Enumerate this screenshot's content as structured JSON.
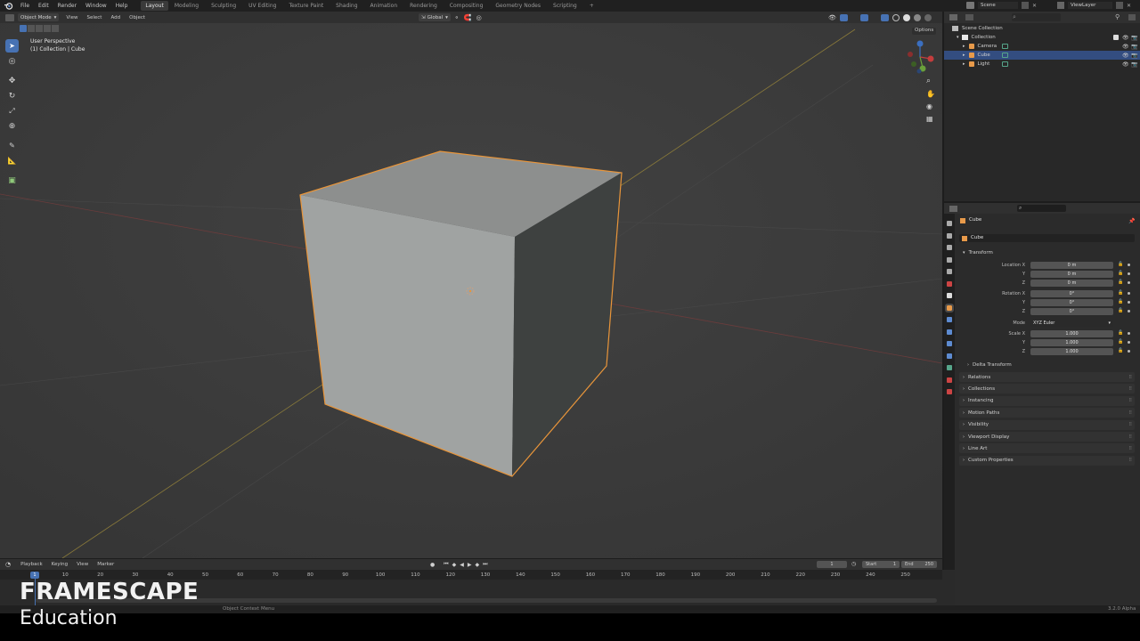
{
  "menu": [
    "File",
    "Edit",
    "Render",
    "Window",
    "Help"
  ],
  "workspaces": [
    {
      "label": "Layout",
      "active": true
    },
    {
      "label": "Modeling"
    },
    {
      "label": "Sculpting"
    },
    {
      "label": "UV Editing"
    },
    {
      "label": "Texture Paint"
    },
    {
      "label": "Shading"
    },
    {
      "label": "Animation"
    },
    {
      "label": "Rendering"
    },
    {
      "label": "Compositing"
    },
    {
      "label": "Geometry Nodes"
    },
    {
      "label": "Scripting"
    }
  ],
  "add_workspace": "+",
  "scene_name": "Scene",
  "view_layer": "ViewLayer",
  "viewport": {
    "mode": "Object Mode",
    "menus": [
      "View",
      "Select",
      "Add",
      "Object"
    ],
    "orientation": "Global",
    "options_label": "Options",
    "overlay_title": "User Perspective",
    "overlay_subtitle": "(1) Collection | Cube"
  },
  "outliner": {
    "root": "Scene Collection",
    "collection": "Collection",
    "items": [
      {
        "name": "Camera",
        "selected": false
      },
      {
        "name": "Cube",
        "selected": true
      },
      {
        "name": "Light",
        "selected": false
      }
    ]
  },
  "properties": {
    "object_name": "Cube",
    "datablock_name": "Cube",
    "transform_label": "Transform",
    "location_label": "Location X",
    "rotation_label": "Rotation X",
    "mode_label": "Mode",
    "mode_value": "XYZ Euler",
    "scale_label": "Scale X",
    "axis_y": "Y",
    "axis_z": "Z",
    "location": [
      "0 m",
      "0 m",
      "0 m"
    ],
    "rotation": [
      "0°",
      "0°",
      "0°"
    ],
    "scale": [
      "1.000",
      "1.000",
      "1.000"
    ],
    "delta": "Delta Transform",
    "sections": [
      "Relations",
      "Collections",
      "Instancing",
      "Motion Paths",
      "Visibility",
      "Viewport Display",
      "Line Art",
      "Custom Properties"
    ]
  },
  "timeline": {
    "menus": [
      "Playback",
      "Keying",
      "View",
      "Marker"
    ],
    "current_frame": "1",
    "start_label": "Start",
    "start_value": "1",
    "end_label": "End",
    "end_value": "250",
    "ticks": [
      "0",
      "10",
      "20",
      "30",
      "40",
      "50",
      "60",
      "70",
      "80",
      "90",
      "100",
      "110",
      "120",
      "130",
      "140",
      "150",
      "160",
      "170",
      "180",
      "190",
      "200",
      "210",
      "220",
      "230",
      "240",
      "250"
    ],
    "current_marker": "1"
  },
  "status": {
    "hint": "Object Context Menu",
    "version": "3.2.0 Alpha"
  },
  "watermark": {
    "brand": "FRAMESCAPE",
    "sub": "Education"
  },
  "colors": {
    "accent": "#4772b3",
    "selection_outline": "#e8953a",
    "viewport_bg": "#3d3d3d"
  }
}
